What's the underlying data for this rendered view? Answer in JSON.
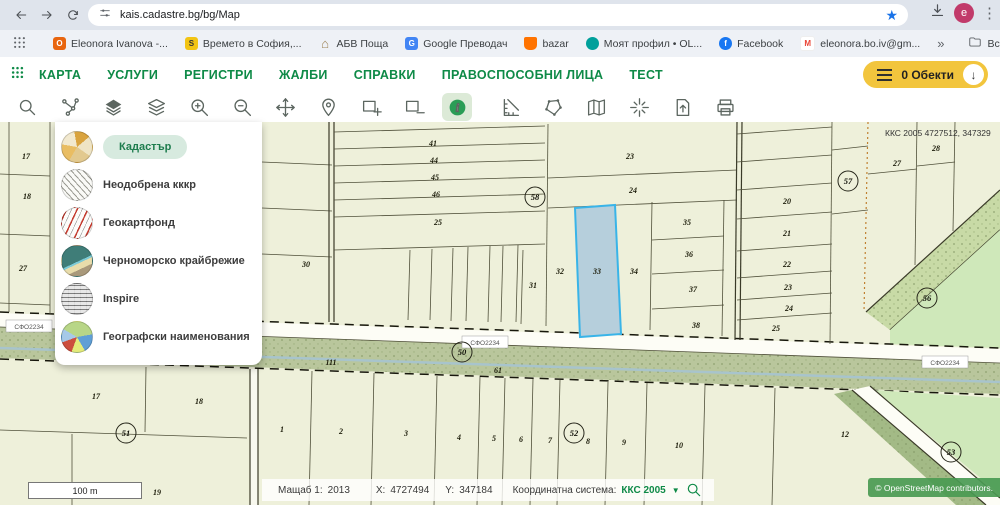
{
  "browser": {
    "url": "kais.cadastre.bg/bg/Map",
    "avatar_letter": "e",
    "more_label": "»",
    "all_bookmarks_label": "Всички отметки",
    "bookmarks": [
      {
        "label": "Eleonora Ivanova -...",
        "glyph": "O"
      },
      {
        "label": "Времето в София,...",
        "glyph": "S"
      },
      {
        "label": "АБВ Поща",
        "glyph": "⌂"
      },
      {
        "label": "Google Преводач",
        "glyph": "G"
      },
      {
        "label": "bazar",
        "glyph": ""
      },
      {
        "label": "Моят профил • OL...",
        "glyph": ""
      },
      {
        "label": "Facebook",
        "glyph": "f"
      },
      {
        "label": "eleonora.bo.iv@gm...",
        "glyph": "M"
      }
    ]
  },
  "nav": {
    "items": [
      "КАРТА",
      "УСЛУГИ",
      "РЕГИСТРИ",
      "ЖАЛБИ",
      "СПРАВКИ",
      "ПРАВОСПОСОБНИ ЛИЦА",
      "ТЕСТ"
    ],
    "objects_button": "0 Обекти"
  },
  "toolbar": {
    "icons": [
      "search",
      "network",
      "layers-filled",
      "layers-stack",
      "zoom-in",
      "zoom-out",
      "pan",
      "locate",
      "rect-plus",
      "rect-minus",
      "info",
      "measure",
      "select-polygon",
      "map",
      "crosshair",
      "export",
      "print"
    ],
    "active_icon": "info"
  },
  "panel": {
    "items": [
      {
        "label": "Кадастър",
        "active": true
      },
      {
        "label": "Неодобрена кккр"
      },
      {
        "label": "Геокартфонд"
      },
      {
        "label": "Черноморско крайбрежие"
      },
      {
        "label": "Inspire"
      },
      {
        "label": "Географски наименования"
      }
    ]
  },
  "map": {
    "selected_parcel": "33",
    "tooltip": "ККС 2005 4727512, 347329",
    "road_label": "СФО2234",
    "labels": {
      "strips": [
        "41",
        "44",
        "45",
        "46",
        "25"
      ],
      "left_column": [
        "17",
        "18",
        "27",
        "30"
      ],
      "block_23_24": [
        "23",
        "24"
      ],
      "row": [
        "31",
        "32",
        "33",
        "34"
      ],
      "stack": [
        "35",
        "36",
        "37",
        "38"
      ],
      "right_column": [
        "20",
        "21",
        "22",
        "23",
        "24",
        "25"
      ],
      "top_right": [
        "27",
        "28"
      ],
      "bottom_left": [
        "17",
        "18",
        "1",
        "2"
      ],
      "bottom_strip": [
        "3",
        "4",
        "5",
        "6",
        "7",
        "8",
        "9",
        "10"
      ],
      "near_road": [
        "111",
        "61"
      ],
      "bottom_right": [
        "12"
      ],
      "near_scale": "19",
      "circled": [
        "58",
        "57",
        "56",
        "50",
        "51",
        "52",
        "53"
      ]
    }
  },
  "statusbar": {
    "scalebar_label": "100 m",
    "scale_label": "Мащаб 1:",
    "scale_value": "2013",
    "x_label": "X:",
    "x_value": "4727494",
    "y_label": "Y:",
    "y_value": "347184",
    "crs_label": "Координатна система:",
    "crs_value": "ККС 2005"
  },
  "attribution": "© OpenStreetMap contributors."
}
